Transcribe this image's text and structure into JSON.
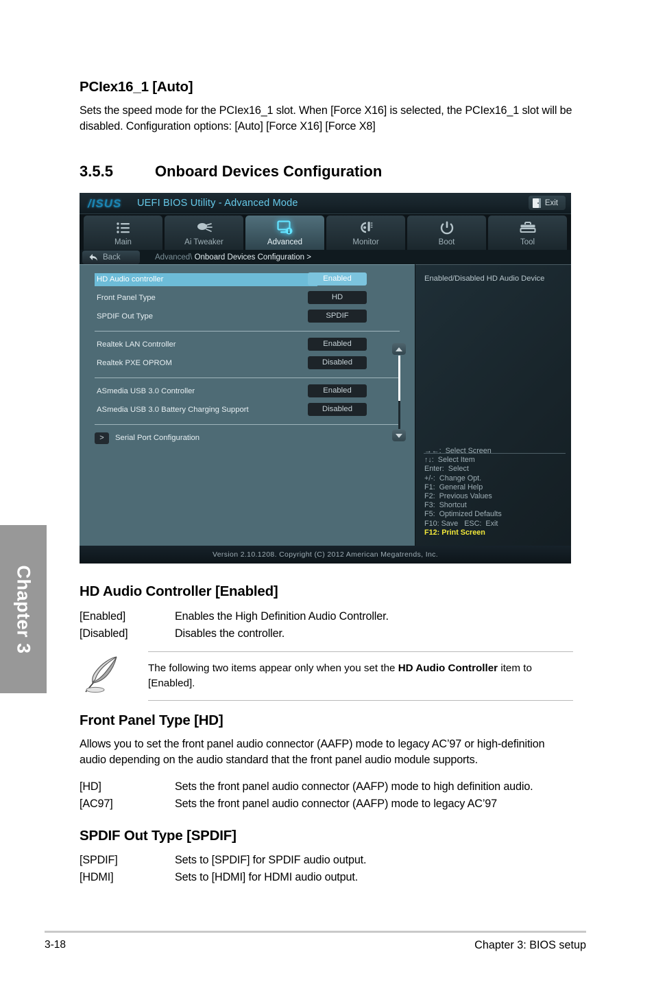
{
  "chapter_tab": {
    "label": "Chapter 3"
  },
  "sections": {
    "pciex": {
      "heading": "PCIex16_1 [Auto]",
      "body": "Sets the speed mode for the PCIex16_1 slot. When [Force X16] is selected, the PCIex16_1 slot will be disabled. Configuration options: [Auto] [Force X16] [Force X8]"
    },
    "numbered": {
      "number": "3.5.5",
      "title": "Onboard Devices Configuration"
    },
    "hd_audio": {
      "heading": "HD Audio Controller [Enabled]",
      "options": [
        {
          "key": "[Enabled]",
          "desc": "Enables the High Definition Audio Controller."
        },
        {
          "key": "[Disabled]",
          "desc": "Disables the controller."
        }
      ],
      "note_pre": "The following two items appear only when you set the ",
      "note_bold": "HD Audio Controller",
      "note_post": " item to [Enabled]."
    },
    "front_panel": {
      "heading": "Front Panel Type [HD]",
      "body": "Allows you to set the front panel audio connector (AAFP) mode to legacy AC’97 or high-definition audio depending on the audio standard that the front panel audio module supports.",
      "options": [
        {
          "key": "[HD]",
          "desc": "Sets the front panel audio connector (AAFP) mode to high definition audio."
        },
        {
          "key": "[AC97]",
          "desc": "Sets the front panel audio connector (AAFP) mode to legacy AC’97"
        }
      ]
    },
    "spdif": {
      "heading": "SPDIF Out Type [SPDIF]",
      "options": [
        {
          "key": "[SPDIF]",
          "desc": "Sets to [SPDIF] for SPDIF audio output."
        },
        {
          "key": "[HDMI]",
          "desc": "Sets to [HDMI] for HDMI audio output."
        }
      ]
    }
  },
  "bios": {
    "logo": "/ISUS",
    "title": "UEFI BIOS Utility - Advanced Mode",
    "exit_label": "Exit",
    "tabs": [
      {
        "label": "Main",
        "icon": "list-icon",
        "active": false
      },
      {
        "label": "Ai  Tweaker",
        "icon": "tweaker-icon",
        "active": false
      },
      {
        "label": "Advanced",
        "icon": "advanced-monitor-icon",
        "active": true
      },
      {
        "label": "Monitor",
        "icon": "thermometer-icon",
        "active": false
      },
      {
        "label": "Boot",
        "icon": "power-icon",
        "active": false
      },
      {
        "label": "Tool",
        "icon": "toolbox-icon",
        "active": false
      }
    ],
    "back_label": "Back",
    "breadcrumb_parent": "Advanced\\",
    "breadcrumb_current": "Onboard Devices Configuration",
    "breadcrumb_arrow": ">",
    "groups": [
      {
        "rows": [
          {
            "name": "HD Audio controller",
            "value": "Enabled",
            "selected": true
          },
          {
            "name": "Front Panel Type",
            "value": "HD",
            "selected": false
          },
          {
            "name": "SPDIF Out Type",
            "value": "SPDIF",
            "selected": false
          }
        ]
      },
      {
        "rows": [
          {
            "name": "Realtek LAN Controller",
            "value": "Enabled",
            "selected": false
          },
          {
            "name": "Realtek PXE OPROM",
            "value": "Disabled",
            "selected": false
          }
        ]
      },
      {
        "rows": [
          {
            "name": "ASmedia USB 3.0 Controller",
            "value": "Enabled",
            "selected": false
          },
          {
            "name": "ASmedia USB 3.0 Battery Charging Support",
            "value": "Disabled",
            "selected": false
          }
        ]
      }
    ],
    "submenu": {
      "arrow": ">",
      "label": "Serial Port Configuration"
    },
    "help_text": "Enabled/Disabled HD Audio Device",
    "key_legend": [
      "→←:  Select Screen",
      "↑↓:  Select Item",
      "Enter:  Select",
      "+/-:  Change Opt.",
      "F1:  General Help",
      "F2:  Previous Values",
      "F3:  Shortcut",
      "F5:  Optimized Defaults",
      "F10: Save   ESC:  Exit"
    ],
    "key_legend_highlight": "F12: Print Screen",
    "version_line": "Version  2.10.1208.   Copyright  (C)  2012 American  Megatrends,  Inc."
  },
  "page_footer": {
    "page_number": "3-18",
    "right": "Chapter 3: BIOS setup"
  }
}
